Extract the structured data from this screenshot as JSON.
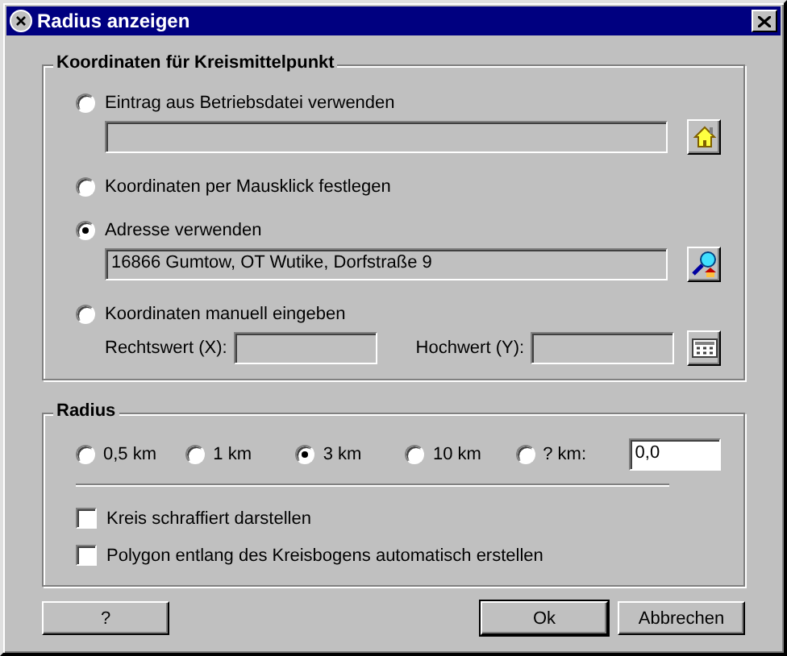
{
  "window": {
    "title": "Radius anzeigen"
  },
  "center_group": {
    "title": "Koordinaten für Kreismittelpunkt",
    "options": [
      {
        "kind": "file-entry",
        "label": "Eintrag aus Betriebsdatei verwenden",
        "selected": false
      },
      {
        "kind": "mouse",
        "label": "Koordinaten per Mausklick festlegen",
        "selected": false
      },
      {
        "kind": "address",
        "label": "Adresse verwenden",
        "selected": true,
        "value": "16866 Gumtow, OT Wutike, Dorfstraße 9"
      },
      {
        "kind": "manual",
        "label": "Koordinaten manuell eingeben",
        "selected": false,
        "x_label": "Rechtswert (X):",
        "y_label": "Hochwert (Y):"
      }
    ]
  },
  "radius_group": {
    "title": "Radius",
    "options": [
      {
        "label": "0,5 km",
        "selected": false
      },
      {
        "label": "1 km",
        "selected": false
      },
      {
        "label": "3 km",
        "selected": true
      },
      {
        "label": "10 km",
        "selected": false
      },
      {
        "label": "? km:",
        "selected": false
      }
    ],
    "custom_value": "0,0",
    "checkboxes": [
      {
        "label": "Kreis schraffiert darstellen",
        "checked": false
      },
      {
        "label": "Polygon entlang des Kreisbogens automatisch erstellen",
        "checked": false
      }
    ]
  },
  "buttons": [
    {
      "label": "?",
      "default": false
    },
    {
      "label": "Ok",
      "default": true
    },
    {
      "label": "Abbrechen",
      "default": false
    }
  ]
}
